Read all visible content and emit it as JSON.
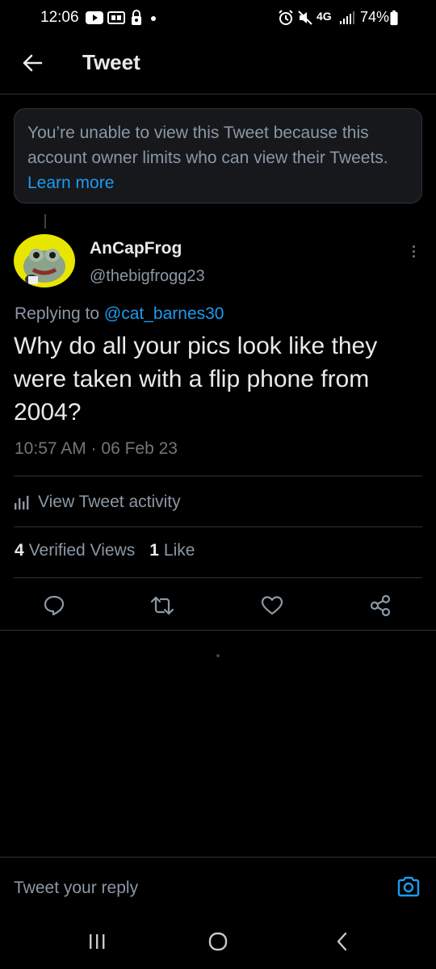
{
  "status_bar": {
    "time": "12:06",
    "battery_percent": "74%",
    "network_label": "4G",
    "left_icons": [
      "youtube-icon",
      "screen-share-icon",
      "lock-icon",
      "dot-icon"
    ],
    "right_icons": [
      "alarm-icon",
      "mute-icon",
      "network-icon",
      "signal-icon",
      "battery-icon"
    ]
  },
  "header": {
    "title": "Tweet",
    "back_icon": "arrow-left-icon"
  },
  "notice": {
    "text": "You’re unable to view this Tweet because this account owner limits who can view their Tweets.",
    "link_label": "Learn more"
  },
  "tweet": {
    "author_name": "AnCapFrog",
    "author_handle": "@thebigfrogg23",
    "replying_to_label": "Replying to",
    "replying_to_handle": "@cat_barnes30",
    "text": "Why do all your pics look like they were taken with a flip phone from 2004?",
    "timestamp": "10:57 AM · 06 Feb 23",
    "activity_label": "View Tweet activity",
    "verified_views_count": "4",
    "verified_views_label": "Verified Views",
    "likes_count": "1",
    "likes_label": "Like",
    "actions": [
      "reply-icon",
      "retweet-icon",
      "like-icon",
      "share-icon"
    ]
  },
  "composer": {
    "placeholder": "Tweet your reply",
    "camera_icon": "camera-icon"
  },
  "system_nav": [
    "recent-apps-icon",
    "home-icon",
    "back-icon"
  ],
  "colors": {
    "background": "#000000",
    "accent": "#1d9bf0",
    "text_primary": "#e7e9ea",
    "text_secondary": "#8b98a5",
    "divider": "#2f3336"
  }
}
